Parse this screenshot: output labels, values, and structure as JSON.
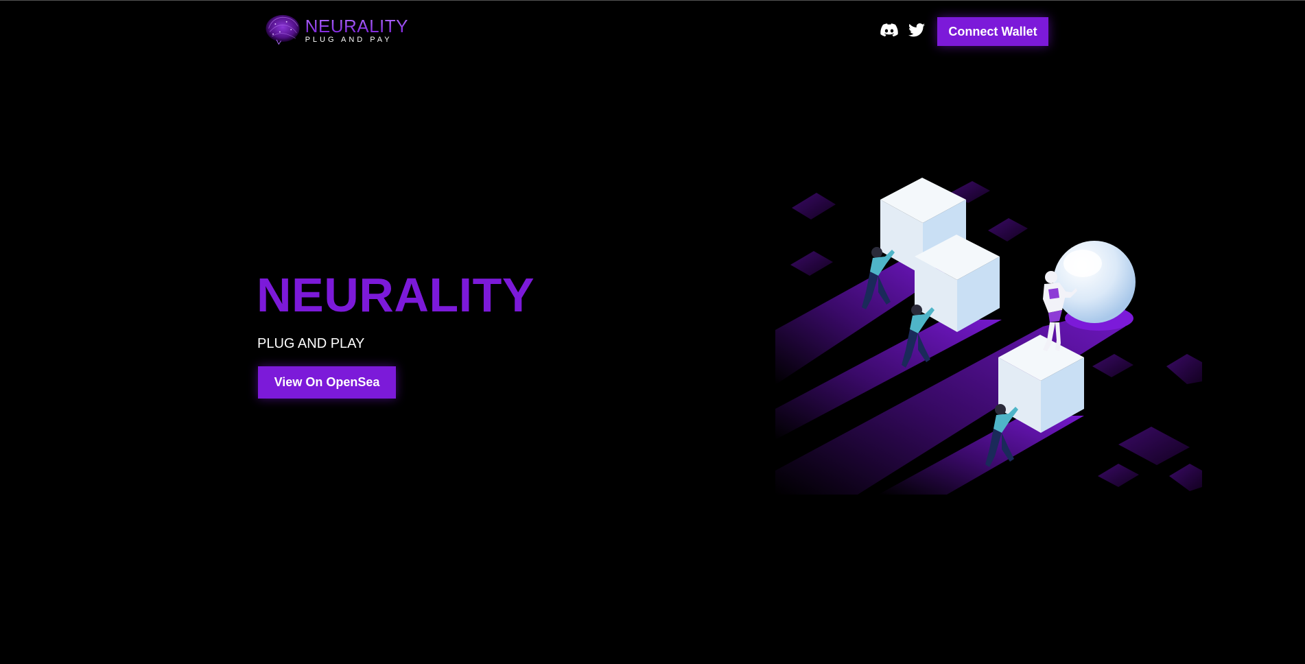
{
  "header": {
    "logo": {
      "title": "NEURALITY",
      "subtitle": "PLUG AND PAY"
    },
    "social": [
      {
        "name": "discord-icon"
      },
      {
        "name": "twitter-icon"
      }
    ],
    "connect_label": "Connect Wallet"
  },
  "hero": {
    "title": "NEURALITY",
    "subtitle": "PLUG AND PLAY",
    "cta_label": "View On OpenSea"
  },
  "colors": {
    "background": "#000000",
    "accent": "#7c1ad9",
    "text": "#ffffff"
  }
}
